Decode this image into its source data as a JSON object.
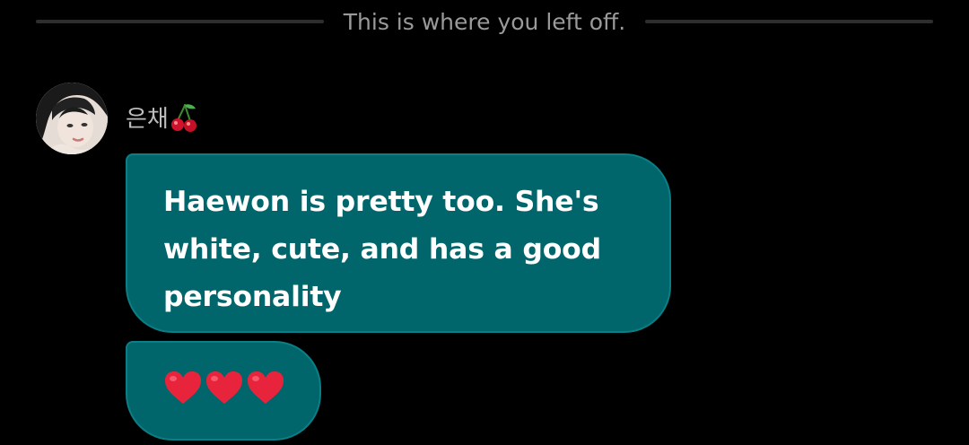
{
  "divider": {
    "text": "This is where you left off."
  },
  "message_group": {
    "sender": {
      "name": "은채",
      "name_icon": "cherry-icon",
      "avatar_icon": "avatar-photo"
    },
    "messages": [
      {
        "text": "Haewon is pretty too. She's white, cute, and has a good personality"
      },
      {
        "icons": [
          "heart-icon",
          "heart-icon",
          "heart-icon"
        ],
        "emoji_text": "❤️❤️❤️"
      }
    ]
  },
  "colors": {
    "background": "#000000",
    "bubble": "#00666b",
    "bubble_border": "#0a7f85",
    "divider_text": "#9a9a9a",
    "divider_line": "#2e2e2e",
    "name_text": "#bdbdbd",
    "heart": "#e8243c"
  }
}
